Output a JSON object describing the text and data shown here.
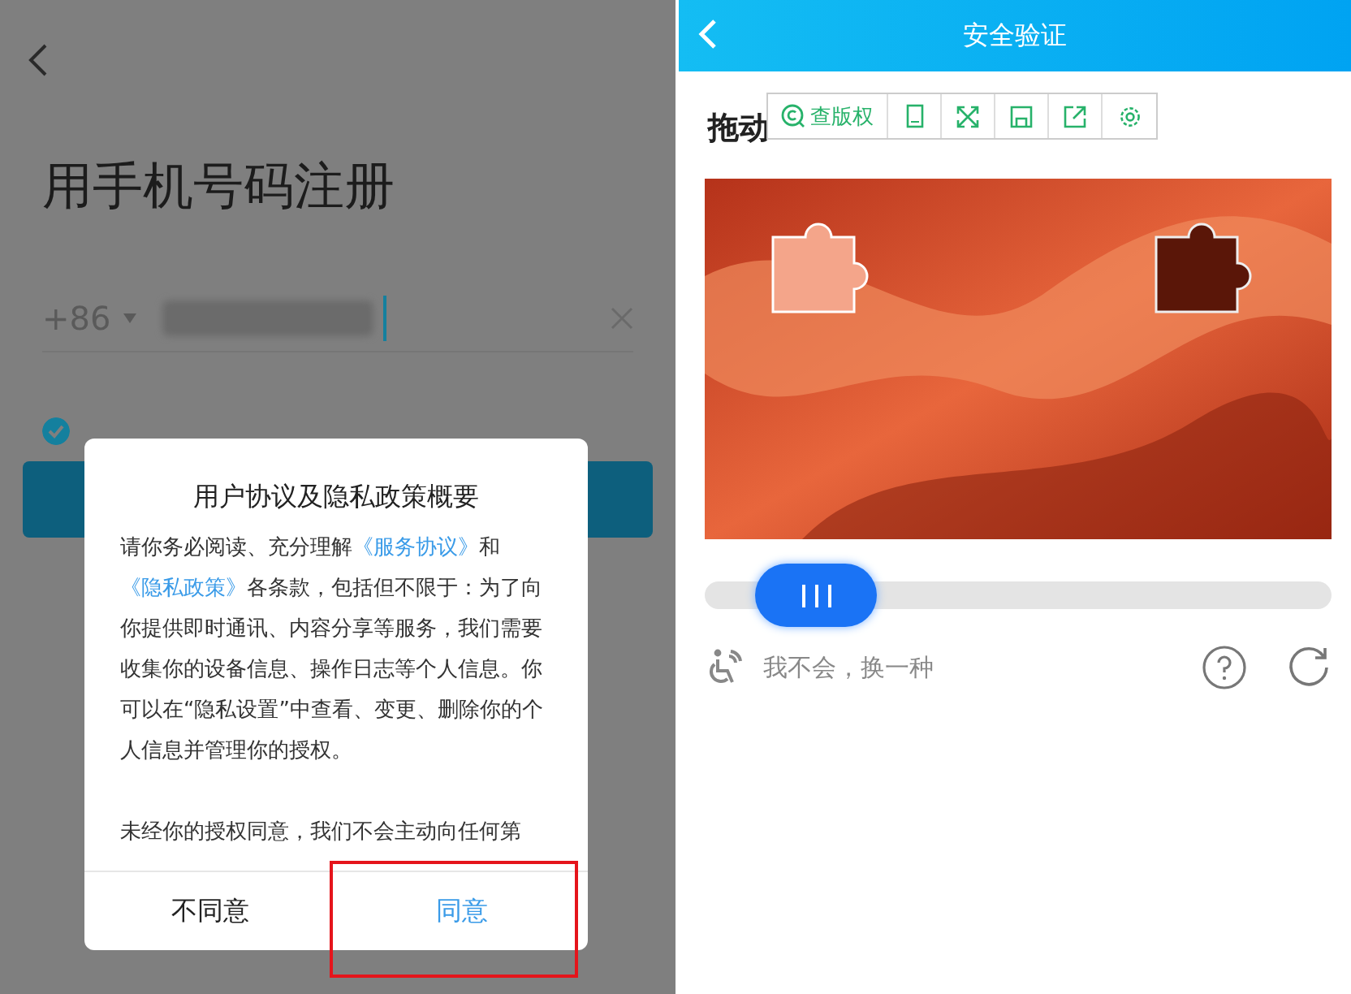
{
  "left": {
    "title": "用手机号码注册",
    "country_code": "+86",
    "agree_checked": true,
    "dialog": {
      "title": "用户协议及隐私政策概要",
      "paragraphs": [
        [
          {
            "kind": "plain",
            "text": "请你务必阅读、充分理解"
          },
          {
            "kind": "link",
            "text": "《服务协议》"
          },
          {
            "kind": "plain",
            "text": "和"
          },
          {
            "kind": "link",
            "text": "《隐私政策》"
          },
          {
            "kind": "plain",
            "text": "各条款，包括但不限于：为了向你提供即时通讯、内容分享等服务，我们需要收集你的设备信息、操作日志等个人信息。你可以在“隐私设置”中查看、变更、删除你的个人信息并管理你的授权。"
          }
        ],
        [
          {
            "kind": "plain",
            "text": "未经你的授权同意，我们不会主动向任何第"
          }
        ]
      ],
      "buttons": [
        {
          "label": "不同意",
          "primary": false,
          "highlighted": false
        },
        {
          "label": "同意",
          "primary": true,
          "highlighted": true
        }
      ]
    }
  },
  "right": {
    "header": {
      "title": "安全验证"
    },
    "instruction": "拖动",
    "toolbar": {
      "label": "查版权"
    },
    "slider": {
      "level": 0.1
    },
    "alt_link": "我不会，换一种"
  }
}
